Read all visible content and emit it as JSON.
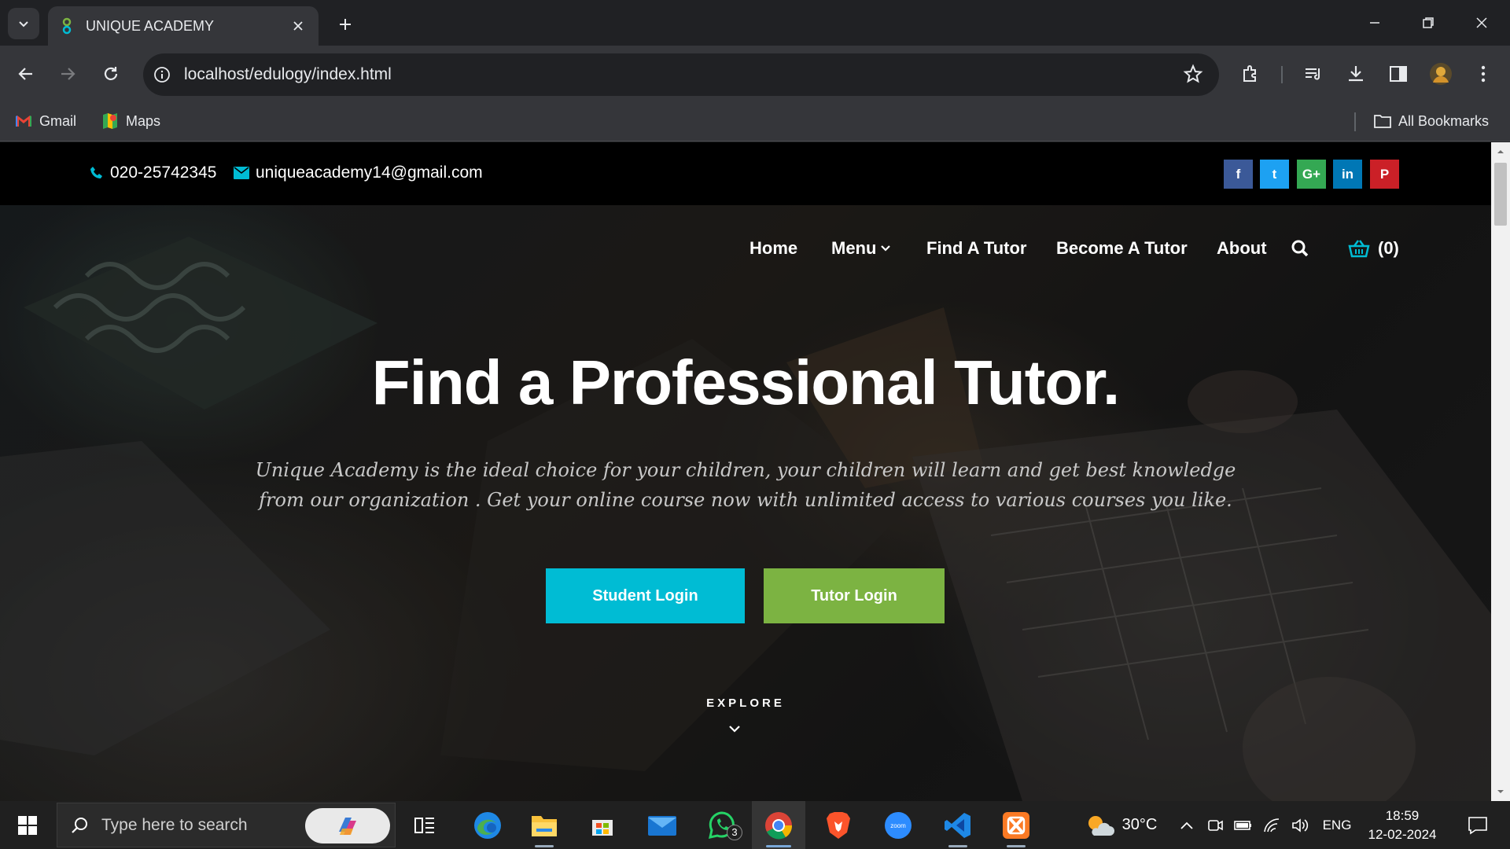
{
  "browser": {
    "tab_title": "UNIQUE ACADEMY",
    "url": "localhost/edulogy/index.html",
    "bookmarks": [
      {
        "label": "Gmail",
        "icon": "gmail-icon"
      },
      {
        "label": "Maps",
        "icon": "maps-icon"
      }
    ],
    "all_bookmarks_label": "All Bookmarks"
  },
  "topbar": {
    "phone": "020-25742345",
    "email": "uniqueacademy14@gmail.com",
    "social": [
      {
        "name": "facebook",
        "glyph": "f",
        "color": "#3b5998"
      },
      {
        "name": "twitter",
        "glyph": "t",
        "color": "#1da1f2"
      },
      {
        "name": "google-plus",
        "glyph": "G+",
        "color": "#34a853"
      },
      {
        "name": "linkedin",
        "glyph": "in",
        "color": "#0077b5"
      },
      {
        "name": "pinterest",
        "glyph": "P",
        "color": "#cb2027"
      }
    ]
  },
  "nav": {
    "items": [
      "Home",
      "Menu",
      "Find A Tutor",
      "Become A Tutor",
      "About"
    ],
    "cart_count": "(0)"
  },
  "hero": {
    "title": "Find a Professional Tutor.",
    "lead": "Unique Academy is the ideal choice for your children, your children will learn and get best knowledge from our organization . Get your online course now with unlimited access to various courses you like.",
    "student_login": "Student Login",
    "tutor_login": "Tutor Login",
    "explore": "EXPLORE"
  },
  "colors": {
    "accent_cyan": "#00bcd4",
    "accent_green": "#7cb342"
  },
  "taskbar": {
    "search_placeholder": "Type here to search",
    "weather": "30°C",
    "language": "ENG",
    "time": "18:59",
    "date": "12-02-2024",
    "whatsapp_badge": "3"
  }
}
